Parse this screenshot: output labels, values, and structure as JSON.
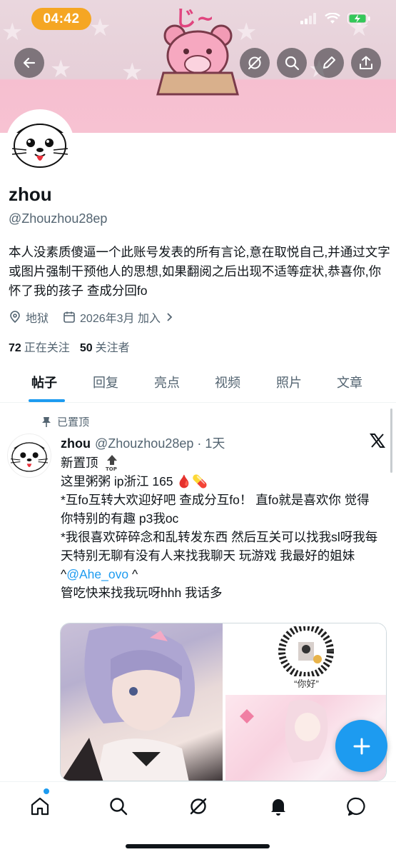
{
  "status_bar": {
    "time": "04:42"
  },
  "banner": {
    "art_text": "じ~"
  },
  "profile": {
    "name": "zhou",
    "handle": "@Zhouzhou28ep",
    "bio": "本人没素质傻逼一个此账号发表的所有言论,意在取悦自己,并通过文字或图片强制干预他人的思想,如果翻阅之后出现不适等症状,恭喜你,你怀了我的孩子 查成分回fo",
    "location": "地狱",
    "joined": "2026年3月 加入",
    "following_count": "72",
    "following_label": "正在关注",
    "followers_count": "50",
    "followers_label": "关注者"
  },
  "tabs": [
    "帖子",
    "回复",
    "亮点",
    "视频",
    "照片",
    "文章"
  ],
  "pinned_label": "已置顶",
  "post": {
    "name": "zhou",
    "handle_time": "@Zhouzhou28ep · 1天",
    "line1": "新置顶",
    "line2": "这里粥粥 ip浙江 165 🩸💊",
    "line3": "*互fo互转大欢迎好吧 查成分互fo！ 直fo就是喜欢你 觉得你特别的有趣 p3我oc",
    "line4a": "*我很喜欢碎碎念和乱转发东西 然后互关可以找我sl呀我每天特别无聊有没有人来找我聊天 玩游戏 我最好的姐妹^",
    "mention": "@Ahe_ovo",
    "line4b": " ^",
    "line5": "管吃快来找我玩呀hhh 我话多",
    "qr_caption": "“你好”"
  },
  "colors": {
    "accent": "#1d9bf0",
    "time_pill": "#f5a623",
    "text": "#0f1419",
    "muted": "#536471"
  },
  "icons": {
    "top_bar": [
      "back-arrow-icon",
      "grok-icon",
      "search-icon",
      "edit-icon",
      "share-icon"
    ],
    "bottom_nav": [
      "home-icon",
      "search-icon",
      "grok-icon",
      "bell-icon",
      "messages-icon"
    ]
  }
}
